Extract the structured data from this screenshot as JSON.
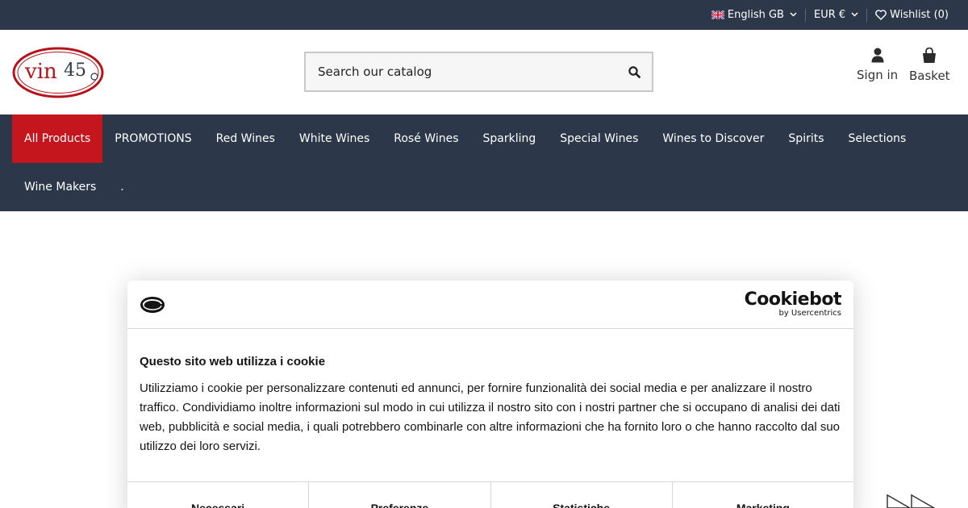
{
  "topbar": {
    "language": "English GB",
    "currency": "EUR €",
    "wishlist": "Wishlist (0)"
  },
  "header": {
    "search_placeholder": "Search our catalog",
    "signin": "Sign in",
    "basket": "Basket"
  },
  "nav": {
    "row1": [
      "All Products",
      "PROMOTIONS",
      "Red Wines",
      "White Wines",
      "Rosé Wines",
      "Sparkling",
      "Special Wines",
      "Wines to Discover",
      "Spirits",
      "Selections"
    ],
    "row2": [
      "Wine Makers",
      "."
    ]
  },
  "cookie": {
    "brand": "Cookiebot",
    "brand_sub": "by Usercentrics",
    "title": "Questo sito web utilizza i cookie",
    "text": "Utilizziamo i cookie per personalizzare contenuti ed annunci, per fornire funzionalità dei social media e per analizzare il nostro traffico. Condividiamo inoltre informazioni sul modo in cui utilizza il nostro sito con i nostri partner che si occupano di analisi dei dati web, pubblicità e social media, i quali potrebbero combinarle con altre informazioni che ha fornito loro o che hanno raccolto dal suo utilizzo dei loro servizi.",
    "tabs": [
      "Necessari",
      "Preferenze",
      "Statistiche",
      "Marketing"
    ]
  },
  "colors": {
    "dark": "#2c3849",
    "accent": "#c4161c"
  }
}
